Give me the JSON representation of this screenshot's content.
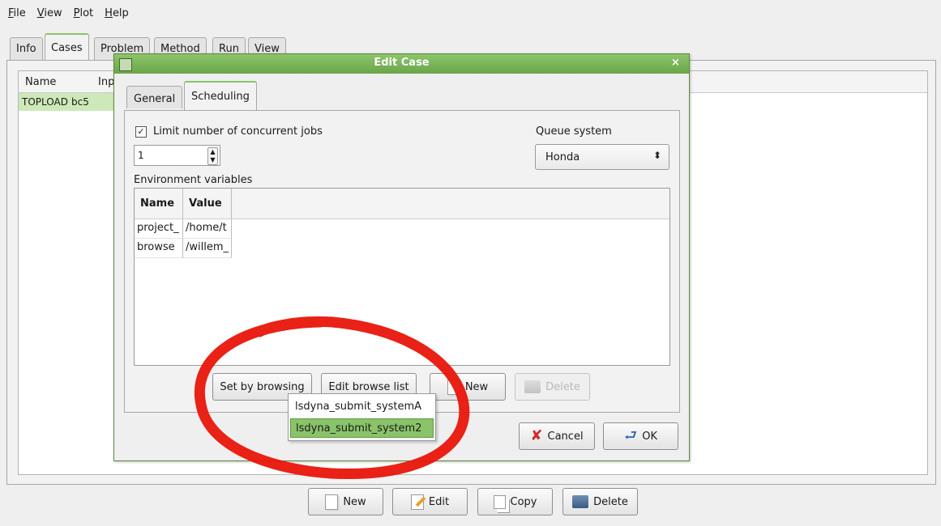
{
  "menubar": {
    "items": [
      "File",
      "View",
      "Plot",
      "Help"
    ],
    "mnemonics": [
      "F",
      "V",
      "P",
      "H"
    ]
  },
  "main_tabs": [
    "Info",
    "Cases",
    "Problem",
    "Method",
    "Run",
    "View"
  ],
  "active_main_tab": "Cases",
  "cases_list": {
    "columns": [
      "Name",
      "Inp"
    ],
    "rows": [
      [
        "TOPLOAD",
        "bc5"
      ]
    ]
  },
  "main_buttons": {
    "new": "New",
    "edit": "Edit",
    "copy": "Copy",
    "delete": "Delete"
  },
  "dialog": {
    "title": "Edit Case",
    "close": "×",
    "tabs": [
      "General",
      "Scheduling"
    ],
    "active_tab": "Scheduling",
    "limit_label": "Limit number of concurrent jobs",
    "limit_checked": true,
    "limit_value": "1",
    "queue_label": "Queue system",
    "queue_value": "Honda",
    "env_label": "Environment variables",
    "env_columns": [
      "Name",
      "Value"
    ],
    "env_rows": [
      [
        "project_",
        "/home/t"
      ],
      [
        "browse",
        "/willem_"
      ]
    ],
    "buttons": {
      "set_by_browsing": "Set by browsing",
      "edit_browse_list": "Edit browse list",
      "new": "New",
      "delete": "Delete",
      "cancel": "Cancel",
      "ok": "OK"
    }
  },
  "browse_popup": {
    "items": [
      "lsdyna_submit_systemA",
      "lsdyna_submit_system2"
    ],
    "selected_index": 1
  },
  "colors": {
    "accent_green": "#8ac36a",
    "annotation_red": "#e8150a"
  }
}
